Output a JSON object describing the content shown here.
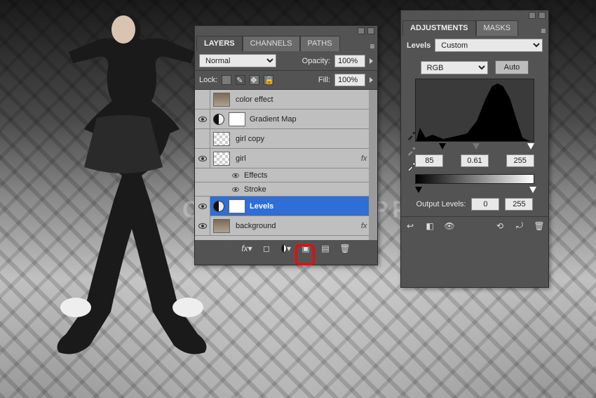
{
  "watermark": "OTOSHOPSUPPLY",
  "layersPanel": {
    "tabs": {
      "layers": "LAYERS",
      "channels": "CHANNELS",
      "paths": "PATHS"
    },
    "blendMode": "Normal",
    "opacityLabel": "Opacity:",
    "opacityValue": "100%",
    "lockLabel": "Lock:",
    "fillLabel": "Fill:",
    "fillValue": "100%",
    "layers": [
      {
        "name": "color effect",
        "visible": false,
        "fx": false,
        "selected": false,
        "thumb": "photo"
      },
      {
        "name": "Gradient Map",
        "visible": true,
        "fx": false,
        "selected": false,
        "thumb": "adj",
        "mask": true
      },
      {
        "name": "girl copy",
        "visible": false,
        "fx": false,
        "selected": false,
        "thumb": "checker"
      },
      {
        "name": "girl",
        "visible": true,
        "fx": true,
        "selected": false,
        "thumb": "checker"
      },
      {
        "name": "Levels",
        "visible": true,
        "fx": false,
        "selected": true,
        "thumb": "adj",
        "mask": true
      },
      {
        "name": "background",
        "visible": true,
        "fx": true,
        "selected": false,
        "thumb": "photo"
      }
    ],
    "effects": {
      "label": "Effects",
      "stroke": "Stroke"
    }
  },
  "adjPanel": {
    "tabs": {
      "adjustments": "ADJUSTMENTS",
      "masks": "MASKS"
    },
    "title": "Levels",
    "preset": "Custom",
    "channel": "RGB",
    "auto": "Auto",
    "inputs": {
      "black": "85",
      "mid": "0.61",
      "white": "255"
    },
    "outputLabel": "Output Levels:",
    "outputs": {
      "black": "0",
      "white": "255"
    }
  }
}
